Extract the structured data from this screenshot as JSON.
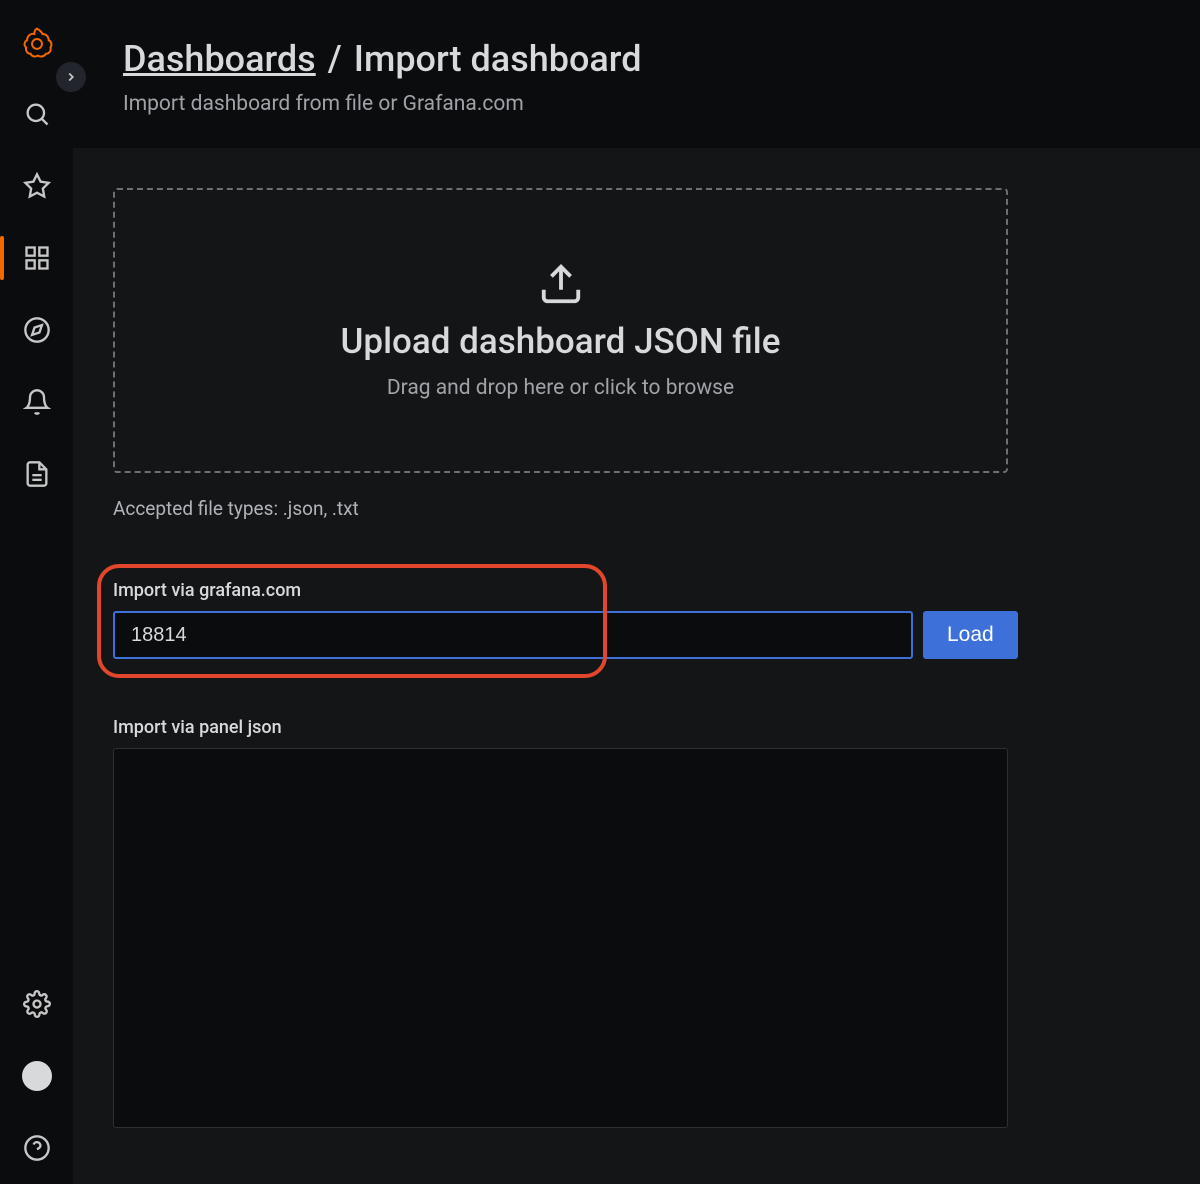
{
  "breadcrumb": {
    "root": "Dashboards",
    "separator": "/",
    "current": "Import dashboard"
  },
  "subtitle": "Import dashboard from file or Grafana.com",
  "upload": {
    "title": "Upload dashboard JSON file",
    "hint": "Drag and drop here or click to browse",
    "accepted": "Accepted file types: .json, .txt"
  },
  "import_via_grafana": {
    "label": "Import via grafana.com",
    "value": "18814",
    "button": "Load"
  },
  "import_via_json": {
    "label": "Import via panel json",
    "value": ""
  }
}
